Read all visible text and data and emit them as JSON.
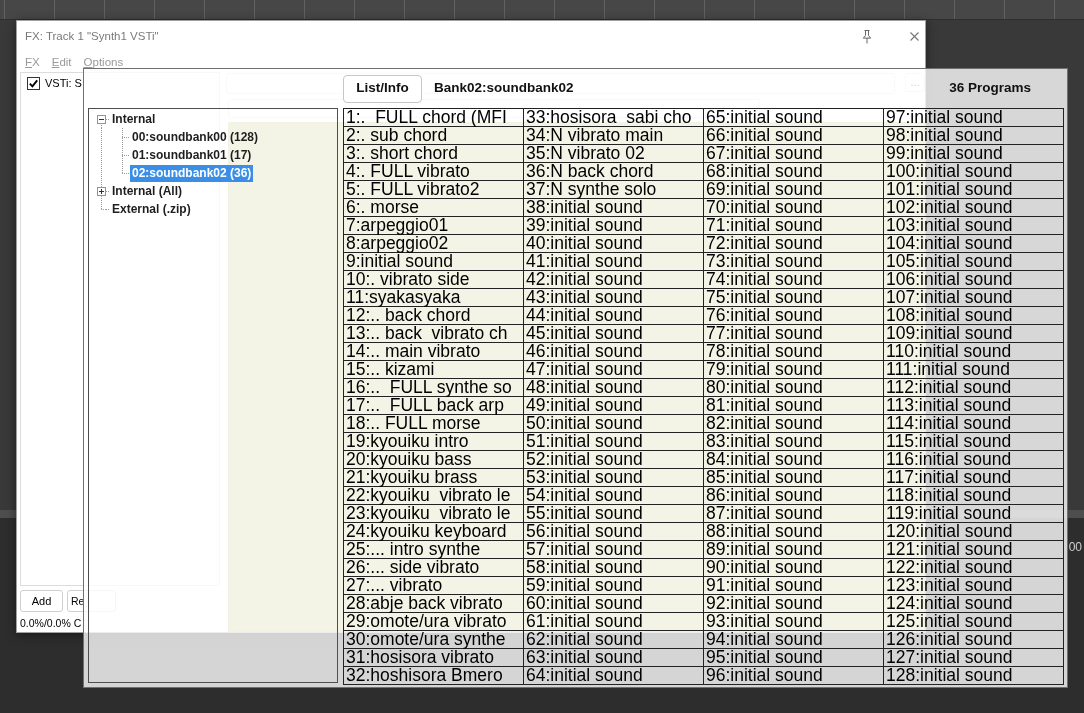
{
  "daw": {
    "time_label": "00"
  },
  "fx_window": {
    "title": "FX: Track 1 \"Synth1 VSTi\"",
    "menu": [
      "FX",
      "Edit",
      "Options"
    ],
    "fx_list": [
      {
        "label": "VSTi: S",
        "checked": true
      }
    ],
    "buttons": [
      "Add",
      "Re"
    ],
    "status": "0.0%/0.0% C",
    "preset_more_button": "..."
  },
  "program_window": {
    "list_info_button": "List/Info",
    "bank_title": "Bank02:soundbank02",
    "program_count": "36 Programs",
    "tree": [
      {
        "label": "Internal",
        "expanded": true,
        "selected": false,
        "children": [
          {
            "label": "00:soundbank00 (128)",
            "selected": false
          },
          {
            "label": "01:soundbank01 (17)",
            "selected": false
          },
          {
            "label": "02:soundbank02 (36)",
            "selected": true
          }
        ]
      },
      {
        "label": "Internal (All)",
        "expanded": false,
        "selected": false
      },
      {
        "label": "External (.zip)",
        "selected": false
      }
    ],
    "programs": [
      "1:.  FULL chord (MFI",
      "2:. sub chord",
      "3:. short chord",
      "4:. FULL vibrato",
      "5:. FULL vibrato2",
      "6:. morse",
      "7:arpeggio01",
      "8:arpeggio02",
      "9:initial sound",
      "10:. vibrato side",
      "11:syakasyaka",
      "12:.. back chord",
      "13:.. back  vibrato ch",
      "14:.. main vibrato",
      "15:.. kizami",
      "16:..  FULL synthe so",
      "17:..  FULL back arp",
      "18:.. FULL morse",
      "19:kyouiku intro",
      "20:kyouiku bass",
      "21:kyouiku brass",
      "22:kyouiku  vibrato le",
      "23:kyouiku  vibrato le",
      "24:kyouiku keyboard",
      "25:... intro synthe",
      "26:... side vibrato",
      "27:... vibrato",
      "28:abje back vibrato",
      "29:omote/ura vibrato",
      "30:omote/ura synthe",
      "31:hosisora vibrato",
      "32:hoshisora Bmero",
      "33:hosisora  sabi cho",
      "34:N vibrato main",
      "35:N vibrato 02",
      "36:N back chord",
      "37:N synthe solo",
      "38:initial sound",
      "39:initial sound",
      "40:initial sound",
      "41:initial sound",
      "42:initial sound",
      "43:initial sound",
      "44:initial sound",
      "45:initial sound",
      "46:initial sound",
      "47:initial sound",
      "48:initial sound",
      "49:initial sound",
      "50:initial sound",
      "51:initial sound",
      "52:initial sound",
      "53:initial sound",
      "54:initial sound",
      "55:initial sound",
      "56:initial sound",
      "57:initial sound",
      "58:initial sound",
      "59:initial sound",
      "60:initial sound",
      "61:initial sound",
      "62:initial sound",
      "63:initial sound",
      "64:initial sound",
      "65:initial sound",
      "66:initial sound",
      "67:initial sound",
      "68:initial sound",
      "69:initial sound",
      "70:initial sound",
      "71:initial sound",
      "72:initial sound",
      "73:initial sound",
      "74:initial sound",
      "75:initial sound",
      "76:initial sound",
      "77:initial sound",
      "78:initial sound",
      "79:initial sound",
      "80:initial sound",
      "81:initial sound",
      "82:initial sound",
      "83:initial sound",
      "84:initial sound",
      "85:initial sound",
      "86:initial sound",
      "87:initial sound",
      "88:initial sound",
      "89:initial sound",
      "90:initial sound",
      "91:initial sound",
      "92:initial sound",
      "93:initial sound",
      "94:initial sound",
      "95:initial sound",
      "96:initial sound",
      "97:initial sound",
      "98:initial sound",
      "99:initial sound",
      "100:initial sound",
      "101:initial sound",
      "102:initial sound",
      "103:initial sound",
      "104:initial sound",
      "105:initial sound",
      "106:initial sound",
      "107:initial sound",
      "108:initial sound",
      "109:initial sound",
      "110:initial sound",
      "111:initial sound",
      "112:initial sound",
      "113:initial sound",
      "114:initial sound",
      "115:initial sound",
      "116:initial sound",
      "117:initial sound",
      "118:initial sound",
      "119:initial sound",
      "120:initial sound",
      "121:initial sound",
      "122:initial sound",
      "123:initial sound",
      "124:initial sound",
      "125:initial sound",
      "126:initial sound",
      "127:initial sound",
      "128:initial sound"
    ]
  }
}
